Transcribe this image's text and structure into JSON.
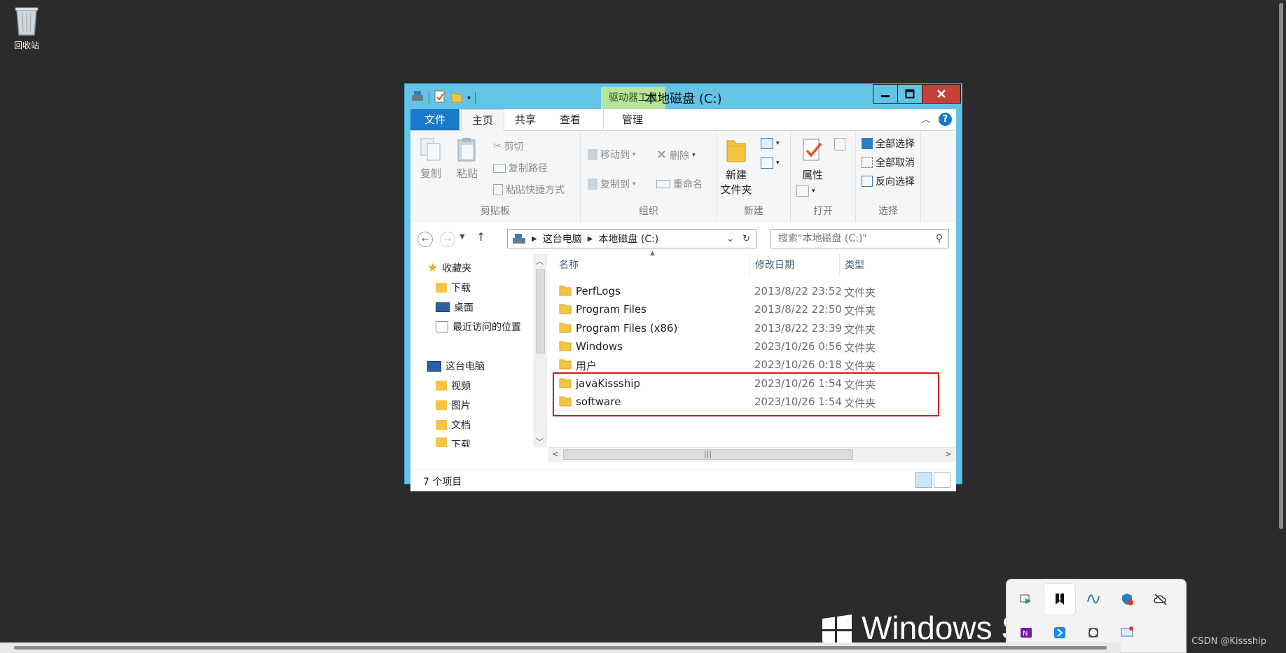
{
  "desktop": {
    "recycle_bin_label": "回收站",
    "os_brand": "Windows Se",
    "watermark": "CSDN @Kissship"
  },
  "window": {
    "title": "本地磁盘 (C:)",
    "context_tab": "驱动器工具",
    "tabs": {
      "file": "文件",
      "home": "主页",
      "share": "共享",
      "view": "查看",
      "manage": "管理"
    },
    "help": "?"
  },
  "ribbon": {
    "clipboard": {
      "label": "剪贴板",
      "copy": "复制",
      "paste": "粘贴",
      "cut": "剪切",
      "copy_path": "复制路径",
      "paste_shortcut": "粘贴快捷方式"
    },
    "organize": {
      "label": "组织",
      "move_to": "移动到",
      "copy_to": "复制到",
      "delete": "删除",
      "rename": "重命名"
    },
    "new": {
      "label": "新建",
      "new_folder_line1": "新建",
      "new_folder_line2": "文件夹"
    },
    "open": {
      "label": "打开",
      "properties": "属性"
    },
    "select": {
      "label": "选择",
      "select_all": "全部选择",
      "select_none": "全部取消",
      "invert": "反向选择"
    }
  },
  "address": {
    "crumbs": [
      "这台电脑",
      "本地磁盘 (C:)"
    ],
    "search_placeholder": "搜索\"本地磁盘 (C:)\""
  },
  "nav_pane": {
    "favorites": "收藏夹",
    "fav_items": [
      "下载",
      "桌面",
      "最近访问的位置"
    ],
    "this_pc": "这台电脑",
    "pc_items": [
      "视频",
      "图片",
      "文档",
      "下载"
    ]
  },
  "columns": {
    "name": "名称",
    "modified": "修改日期",
    "type": "类型"
  },
  "files": [
    {
      "name": "PerfLogs",
      "modified": "2013/8/22 23:52",
      "type": "文件夹"
    },
    {
      "name": "Program Files",
      "modified": "2013/8/22 22:50",
      "type": "文件夹"
    },
    {
      "name": "Program Files (x86)",
      "modified": "2013/8/22 23:39",
      "type": "文件夹"
    },
    {
      "name": "Windows",
      "modified": "2023/10/26 0:56",
      "type": "文件夹"
    },
    {
      "name": "用户",
      "modified": "2023/10/26 0:18",
      "type": "文件夹"
    },
    {
      "name": "javaKissship",
      "modified": "2023/10/26 1:54",
      "type": "文件夹"
    },
    {
      "name": "software",
      "modified": "2023/10/26 1:54",
      "type": "文件夹"
    }
  ],
  "status": {
    "item_count": "7 个项目"
  },
  "colors": {
    "window_frame": "#63c4e6",
    "file_tab": "#1979ca",
    "context_tab": "#b8e39a",
    "close": "#c7403a",
    "highlight": "#e0141e",
    "desktop": "#2b2b2b"
  }
}
